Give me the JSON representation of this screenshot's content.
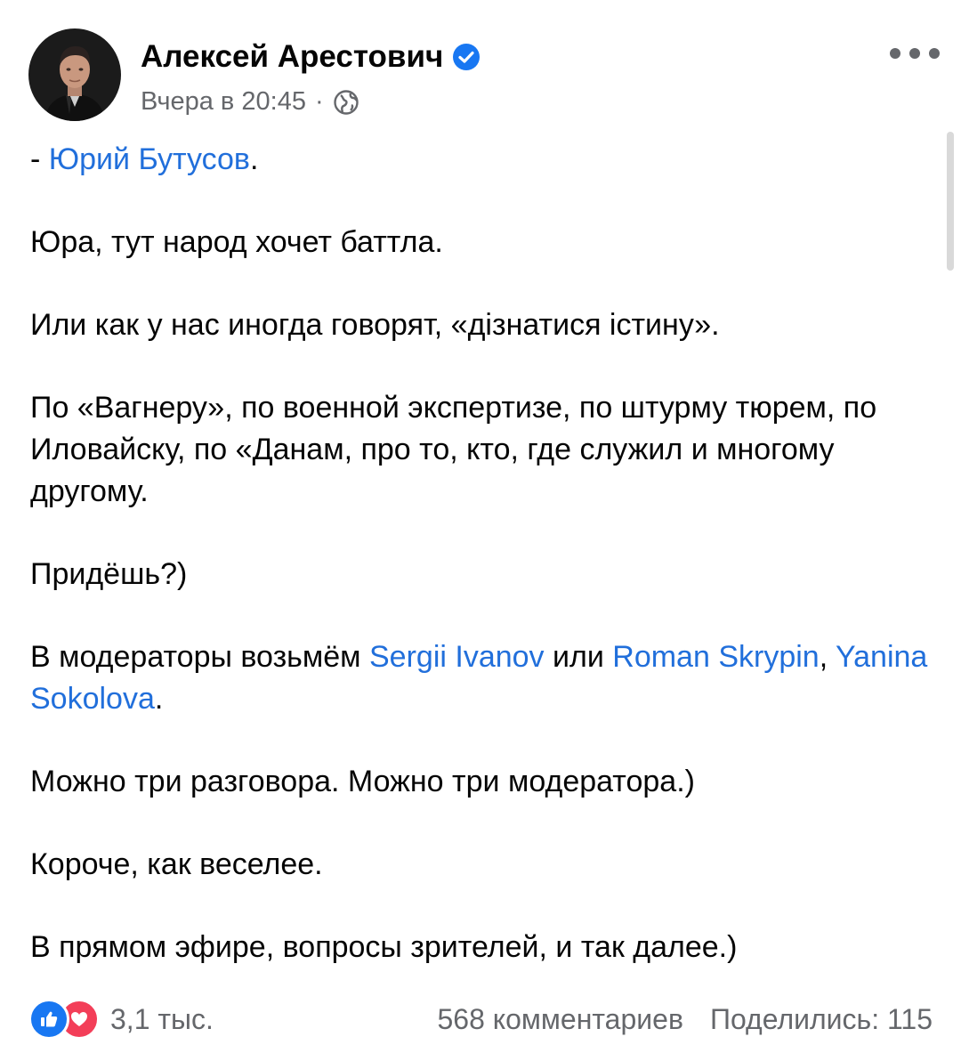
{
  "post": {
    "author": "Алексей Арестович",
    "timestamp": "Вчера в 20:45",
    "separator": "·",
    "audience_icon": "globe-icon",
    "verified_icon": "verified-badge-icon",
    "more_icon": "more-options-icon"
  },
  "body": {
    "p1_prefix": "- ",
    "p1_link": "Юрий Бутусов",
    "p1_suffix": ".",
    "p2": "Юра, тут народ хочет баттла.",
    "p3": "Или как у нас иногда говорят, «дізнатися істину».",
    "p4": "По «Вагнеру», по военной экспертизе, по штурму тюрем, по Иловайску, по «Данам, про то, кто, где служил и многому другому.",
    "p5": "Придёшь?)",
    "p6_prefix": "В модераторы возьмём ",
    "p6_link1": "Sergii Ivanov",
    "p6_mid": " или ",
    "p6_link2": "Roman Skrypin",
    "p6_sep": ", ",
    "p6_link3": "Yanina Sokolova",
    "p6_suffix": ".",
    "p7": "Можно три разговора. Можно три модератора.)",
    "p8": "Короче, как веселее.",
    "p9": "В прямом эфире, вопросы зрителей, и так далее.)"
  },
  "footer": {
    "reactions_count": "3,1 тыс.",
    "comments": "568 комментариев",
    "shares": "Поделились: 115"
  },
  "colors": {
    "link": "#216fdb",
    "secondary_text": "#65676b",
    "like": "#1877f2",
    "love": "#f33e58"
  }
}
